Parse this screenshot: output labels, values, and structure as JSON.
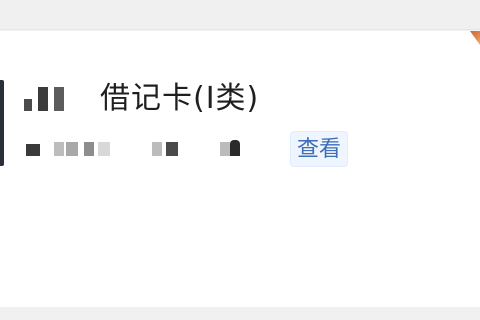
{
  "card": {
    "title": "借记卡(Ⅰ类)",
    "view_label": "查看"
  }
}
